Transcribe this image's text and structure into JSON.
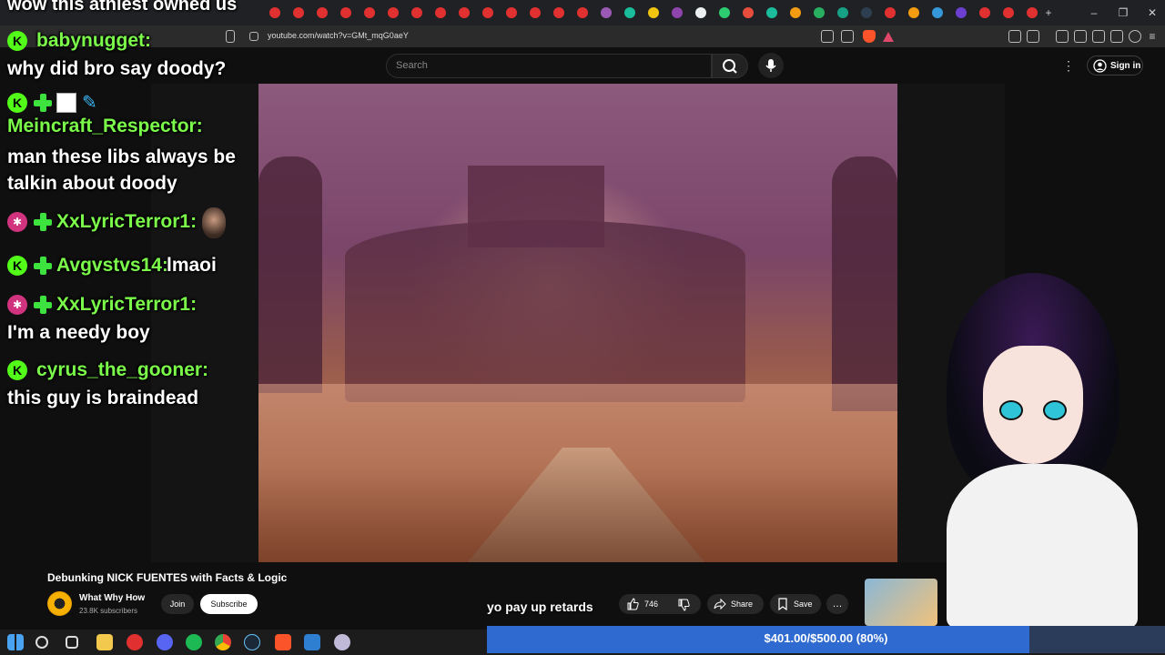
{
  "overlay_title": "wow this athiest owned us",
  "browser": {
    "url": "youtube.com/watch?v=GMt_mqG0aeY"
  },
  "youtube": {
    "search_placeholder": "Search",
    "sign_in": "Sign in",
    "video_title": "Debunking NICK FUENTES with Facts & Logic",
    "channel_name": "What Why How",
    "subscribers": "23.8K subscribers",
    "join_label": "Join",
    "subscribe_label": "Subscribe",
    "likes": "746",
    "share_label": "Share",
    "save_label": "Save",
    "more_label": "…"
  },
  "chat": [
    {
      "user": "babynugget:",
      "message": "why did bro say doody?"
    },
    {
      "user": "Meincraft_Respector:",
      "message": "man these libs always be talkin about doody"
    },
    {
      "user": "XxLyricTerror1:",
      "message": ""
    },
    {
      "user": "Avgvstvs14:",
      "message": "lmaoi"
    },
    {
      "user": "XxLyricTerror1:",
      "message": "I'm a needy boy"
    },
    {
      "user": "cyrus_the_gooner:",
      "message": "this guy is braindead"
    }
  ],
  "stream_overlay": {
    "caption": "yo pay up retards",
    "goal_text": "$401.00/$500.00 (80%)",
    "goal_progress": 0.8
  },
  "colors": {
    "chat_name": "#7cfc4a",
    "goal_fill": "#2e6ad0",
    "kick_green": "#53fc18"
  }
}
